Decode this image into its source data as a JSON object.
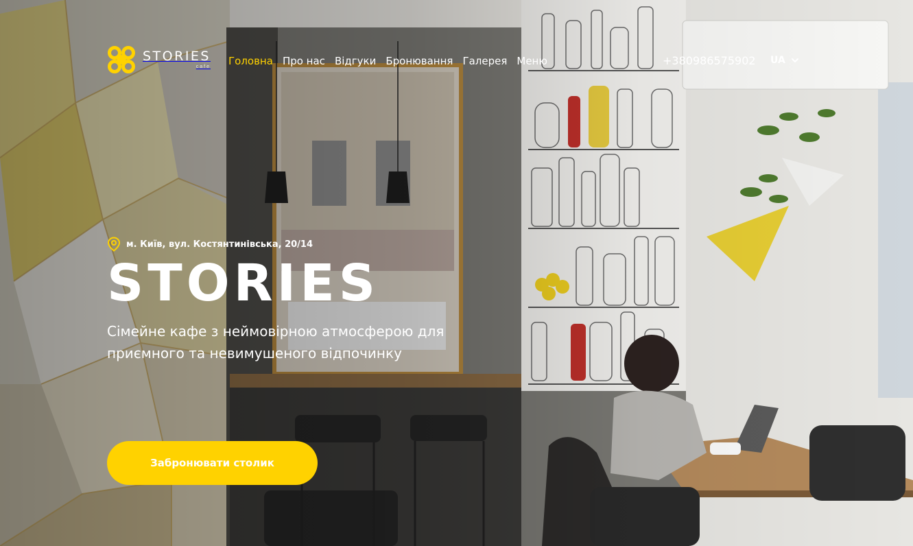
{
  "brand": {
    "name": "STORIES",
    "sub": "cafe",
    "accent": "#ffd200"
  },
  "nav": {
    "items": [
      {
        "label": "Головна",
        "active": true
      },
      {
        "label": "Про нас",
        "active": false
      },
      {
        "label": "Відгуки",
        "active": false
      },
      {
        "label": "Бронювання",
        "active": false
      },
      {
        "label": "Галерея",
        "active": false
      },
      {
        "label": "Меню",
        "active": false
      }
    ]
  },
  "contact": {
    "phone": "+380986575902",
    "language": "UA"
  },
  "hero": {
    "address": "м. Київ, вул. Костянтинівська, 20/14",
    "title": "STORIES",
    "subtitle": "Сімейне кафе з неймовірною атмосферою для приємного та невимушеного відпочинку",
    "cta_label": "Забронювати столик"
  },
  "icons": {
    "logo": "clover-logo-icon",
    "location": "location-pin-icon",
    "language_toggle": "chevron-down-icon"
  }
}
